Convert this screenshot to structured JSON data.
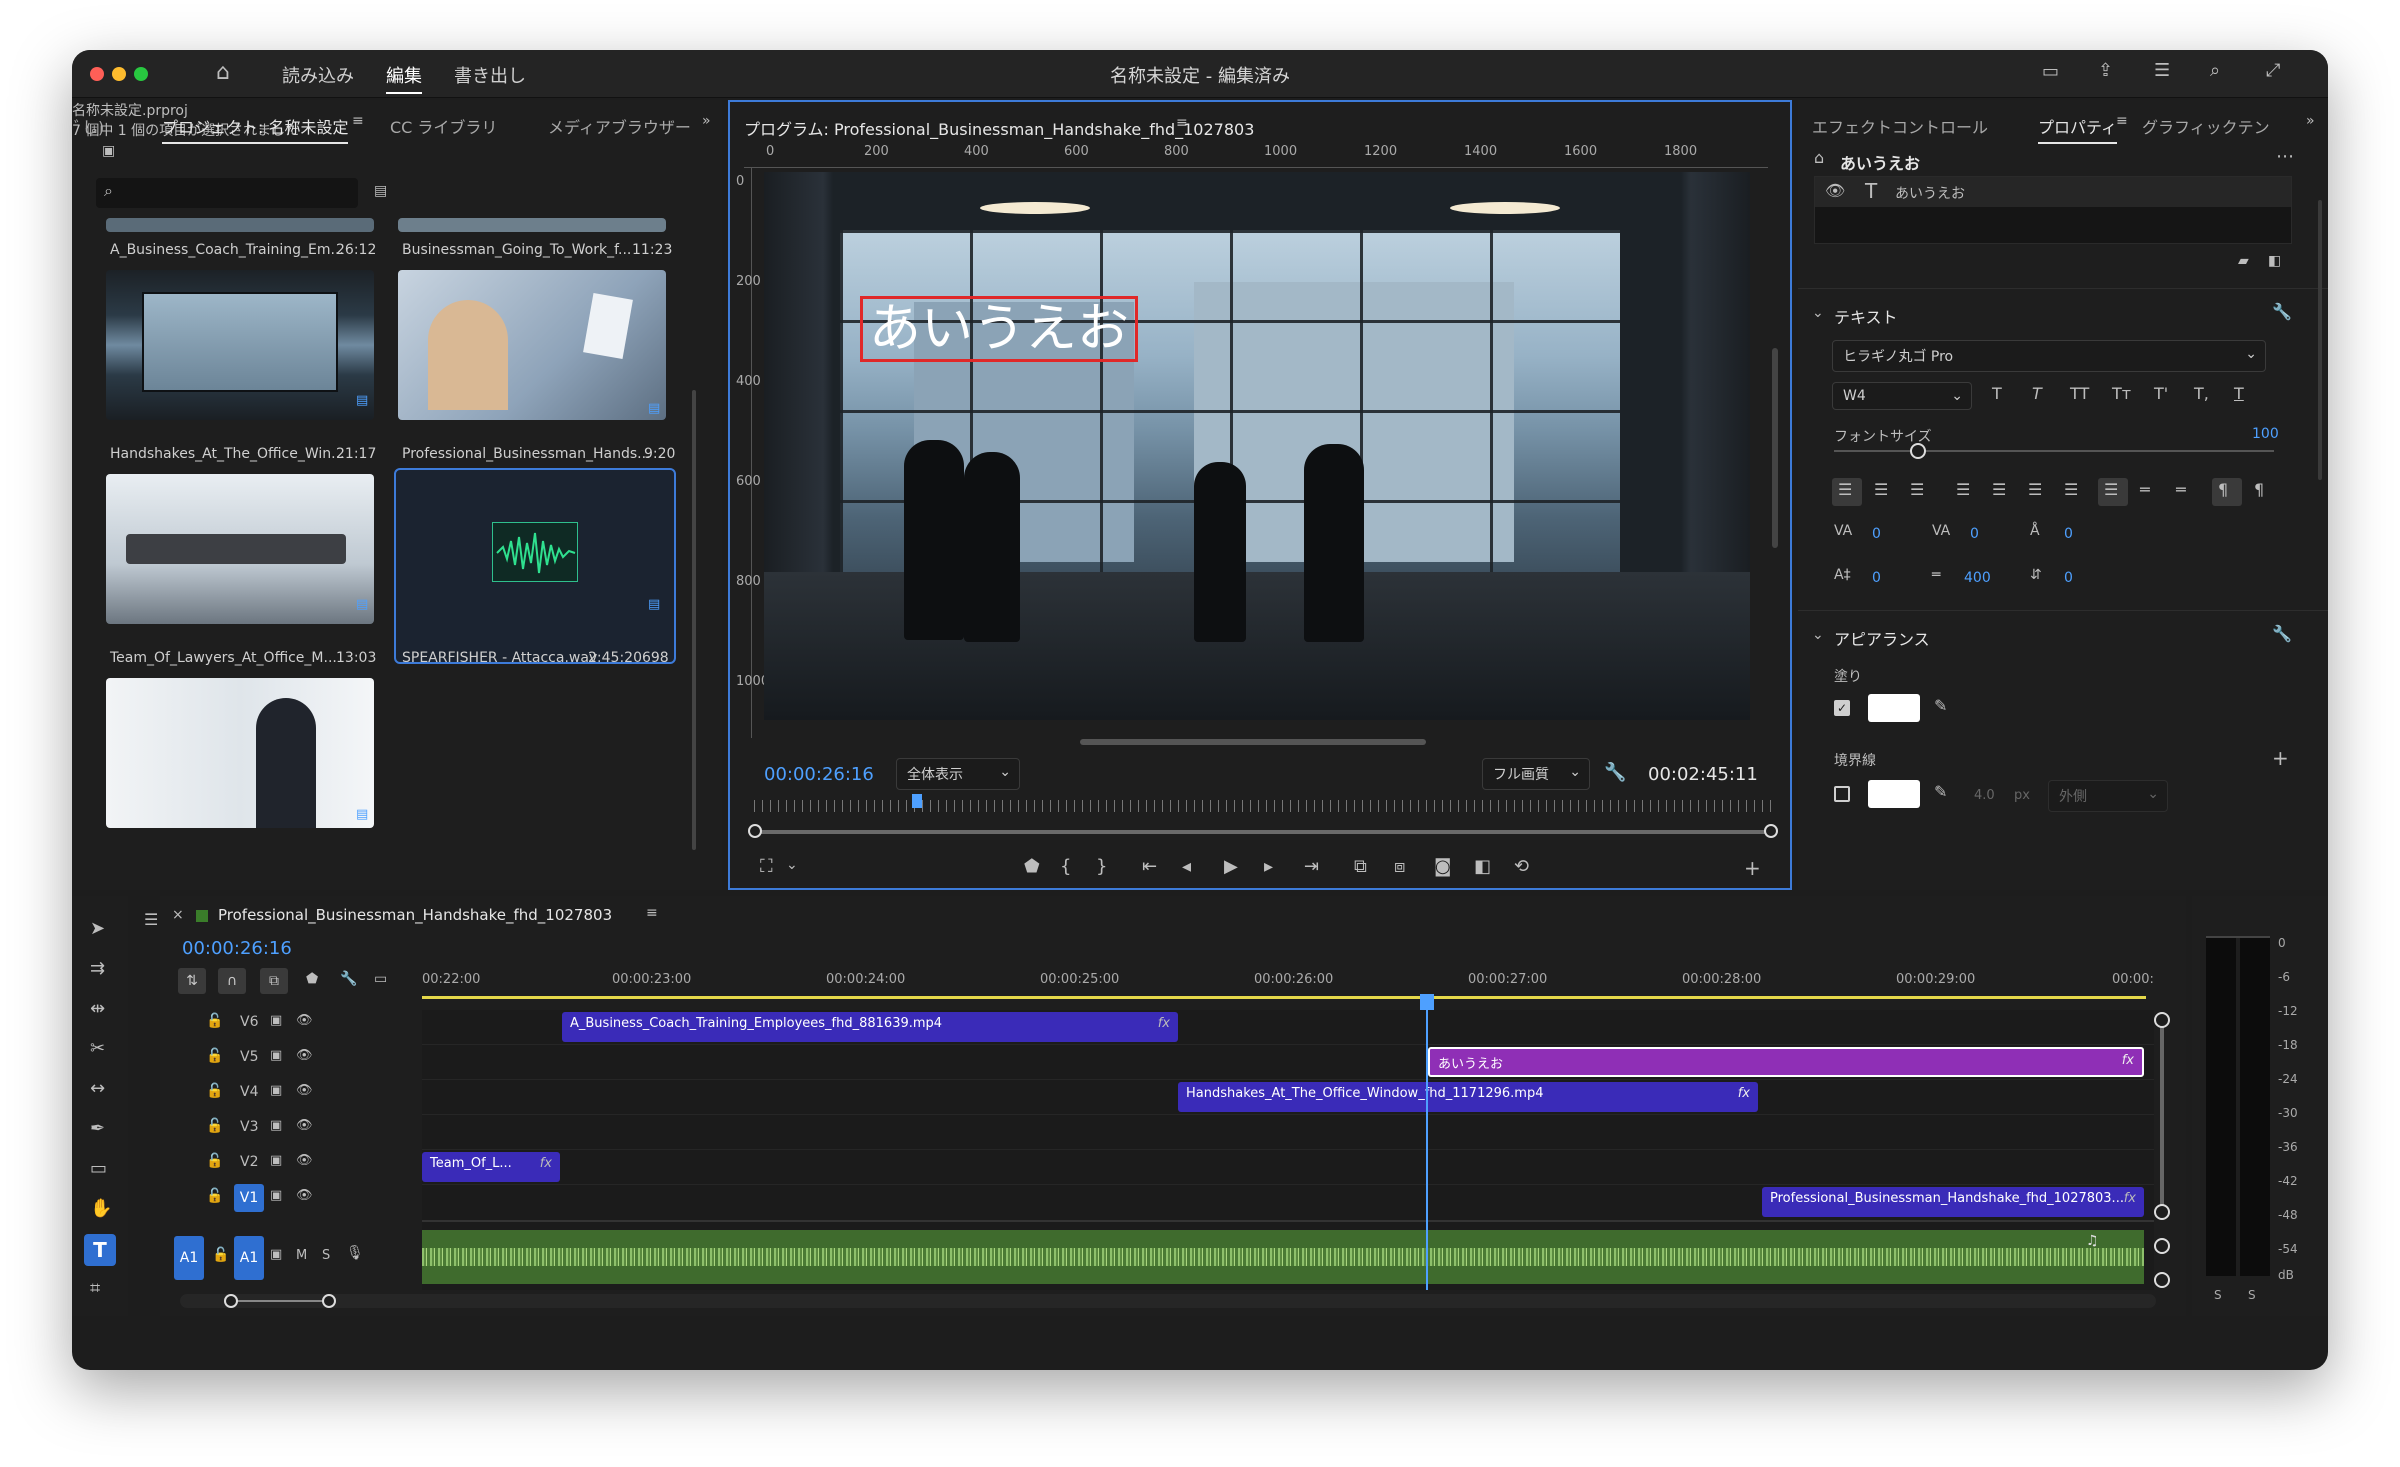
{
  "window": {
    "title": "名称未設定 - 編集済み",
    "nav": [
      "読み込み",
      "編集",
      "書き出し"
    ],
    "active_nav": "編集"
  },
  "project_panel": {
    "tabs": [
      "ﾞし)",
      "プロジェクト: 名称未設定",
      "CC ライブラリ",
      "メディアブラウザー"
    ],
    "file": "名称未設定.prproj",
    "search_placeholder": "",
    "selection_status": "7 個中 1 個の項目が選択されました",
    "items": [
      {
        "name": "A_Business_Coach_Training_Em...",
        "duration": "26:12"
      },
      {
        "name": "Businessman_Going_To_Work_f...",
        "duration": "11:23"
      },
      {
        "name": "Handshakes_At_The_Office_Win...",
        "duration": "21:17"
      },
      {
        "name": "Professional_Businessman_Hands...",
        "duration": "9:20"
      },
      {
        "name": "Team_Of_Lawyers_At_Office_M...",
        "duration": "13:03"
      },
      {
        "name": "SPEARFISHER - Attacca.wav",
        "duration": "2:45:20698"
      }
    ]
  },
  "program_monitor": {
    "title": "プログラム: Professional_Businessman_Handshake_fhd_1027803",
    "ruler_h": [
      "0",
      "200",
      "400",
      "600",
      "800",
      "1000",
      "1200",
      "1400",
      "1600",
      "1800"
    ],
    "ruler_v": [
      "0",
      "200",
      "400",
      "600",
      "800",
      "1000"
    ],
    "overlay_text": "あいうえお",
    "timecode": "00:00:26:16",
    "zoom": "全体表示",
    "quality": "フル画質",
    "duration": "00:02:45:11"
  },
  "effects_panel": {
    "tabs": [
      "エフェクトコントロール",
      "プロパティ",
      "グラフィックテン"
    ],
    "active_tab": "プロパティ",
    "layer_title": "あいうえお",
    "layer_name": "あいうえお",
    "text_section": "テキスト",
    "font": "ヒラギノ丸ゴ Pro",
    "weight": "W4",
    "style_buttons": [
      "T",
      "T",
      "TT",
      "Tт",
      "T'",
      "T,",
      "T"
    ],
    "font_size_label": "フォントサイズ",
    "font_size": "100",
    "metrics": [
      {
        "label": "VA",
        "value": "0"
      },
      {
        "label": "VA",
        "value": "0"
      },
      {
        "label": "Å",
        "value": "0"
      },
      {
        "label": "A‡",
        "value": "0"
      },
      {
        "label": "═",
        "value": "400"
      },
      {
        "label": "⇵",
        "value": "0"
      }
    ],
    "appearance_section": "アピアランス",
    "fill_label": "塗り",
    "stroke_label": "境界線",
    "stroke_width": "4.0",
    "stroke_unit": "px",
    "stroke_position": "外側"
  },
  "timeline": {
    "sequence": "Professional_Businessman_Handshake_fhd_1027803",
    "timecode": "00:00:26:16",
    "ruler": [
      "00:22:00",
      "00:00:23:00",
      "00:00:24:00",
      "00:00:25:00",
      "00:00:26:00",
      "00:00:27:00",
      "00:00:28:00",
      "00:00:29:00",
      "00:00:"
    ],
    "tracks": [
      "V6",
      "V5",
      "V4",
      "V3",
      "V2",
      "V1",
      "A1"
    ],
    "clips": [
      {
        "track": "V6",
        "name": "A_Business_Coach_Training_Employees_fhd_881639.mp4"
      },
      {
        "track": "V5",
        "name": "あいうえお"
      },
      {
        "track": "V4",
        "name": "Handshakes_At_The_Office_Window_fhd_1171296.mp4"
      },
      {
        "track": "V2",
        "name": "Team_Of_L..."
      },
      {
        "track": "V1",
        "name": "Professional_Businessman_Handshake_fhd_1027803..."
      }
    ],
    "audio_labels": {
      "m": "M",
      "s": "S"
    },
    "fx": "fx"
  },
  "meter": {
    "scale": [
      "0",
      "-6",
      "-12",
      "-18",
      "-24",
      "-30",
      "-36",
      "-42",
      "-48",
      "-54",
      "dB"
    ],
    "bottom": [
      "S",
      "S"
    ]
  },
  "colors": {
    "accent": "#4ea0ff",
    "clip_blue": "#3a2bb8",
    "clip_purple": "#8f2fb6",
    "audio_green": "#3f6b2d",
    "timeline_yellow": "#e5d84a"
  }
}
